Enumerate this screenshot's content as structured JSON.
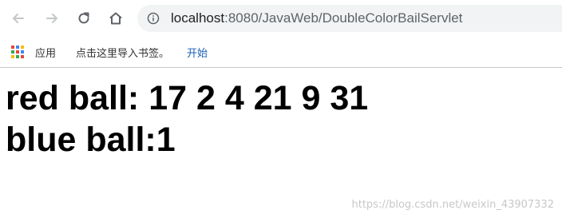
{
  "browser": {
    "address_bar": {
      "host": "localhost",
      "path": ":8080/JavaWeb/DoubleColorBailServlet"
    },
    "bookmarks_bar": {
      "apps_label": "应用",
      "import_hint": "点击这里导入书签。",
      "start_link": "开始"
    }
  },
  "page": {
    "red_line": "red ball: 17 2 4 21 9 31",
    "blue_line": "blue ball:1"
  },
  "watermark": "https://blog.csdn.net/weixin_43907332"
}
